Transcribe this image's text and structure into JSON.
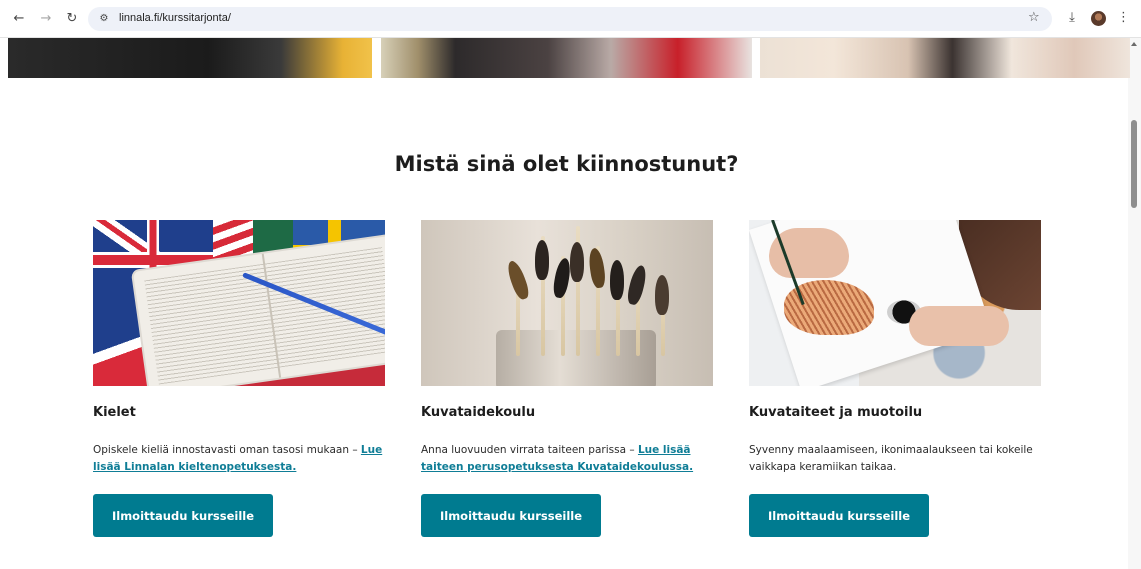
{
  "browser": {
    "url": "linnala.fi/kurssitarjonta/",
    "icons": {
      "back": "arrow-left-icon",
      "forward": "arrow-right-icon",
      "reload": "reload-icon",
      "site_info": "site-settings-icon",
      "bookmark": "star-icon",
      "download": "download-icon",
      "profile": "avatar",
      "menu": "more-vertical-icon"
    }
  },
  "section": {
    "title": "Mistä sinä olet kiinnostunut?"
  },
  "cards": [
    {
      "title": "Kielet",
      "text": "Opiskele kieliä innostavasti oman tasosi mukaan – ",
      "link": "Lue lisää Linnalan kieltenopetuksesta.",
      "button": "Ilmoittaudu kursseille"
    },
    {
      "title": "Kuvataidekoulu",
      "text": "Anna luovuuden virrata taiteen parissa – ",
      "link": "Lue lisää taiteen perusopetuksesta Kuvataidekoulussa.",
      "button": "Ilmoittaudu kursseille"
    },
    {
      "title": "Kuvataiteet ja muotoilu",
      "text": "Syvenny maalaamiseen, ikonimaalaukseen tai kokeile vaikkapa keramiikan taikaa.",
      "link": "",
      "button": "Ilmoittaudu kursseille"
    }
  ],
  "colors": {
    "accent": "#007b90",
    "link": "#0f7d96"
  }
}
